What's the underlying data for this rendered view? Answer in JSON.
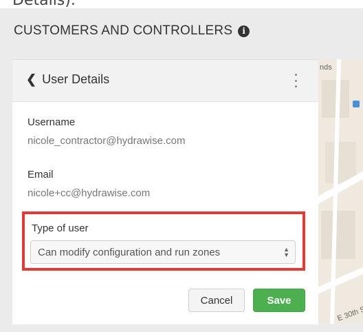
{
  "top_fragment": "Details).",
  "page": {
    "title": "CUSTOMERS AND CONTROLLERS",
    "info_icon": "info-circle-icon"
  },
  "panel": {
    "back_label": "User Details",
    "back_icon": "chevron-left-icon",
    "menu_icon": "kebab-menu-icon",
    "username_label": "Username",
    "username_value": "nicole_contractor@hydrawise.com",
    "email_label": "Email",
    "email_value": "nicole+cc@hydrawise.com",
    "type_label": "Type of user",
    "type_selected": "Can modify configuration and run zones",
    "cancel_label": "Cancel",
    "save_label": "Save"
  },
  "map": {
    "label_top": "nds",
    "street_label": "E 30th S"
  },
  "colors": {
    "highlight_border": "#e53935",
    "save_button": "#4caf50"
  }
}
